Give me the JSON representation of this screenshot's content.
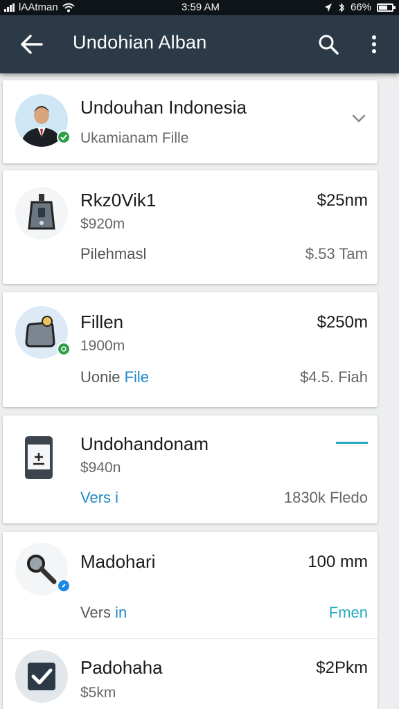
{
  "status_bar": {
    "carrier": "lAAtman",
    "time": "3:59 AM",
    "battery": "66%",
    "battery_level": 0.66
  },
  "app_bar": {
    "title": "Undohian Alban",
    "back_icon": "arrow-left-icon",
    "search_icon": "search-icon",
    "more_icon": "more-vert-icon"
  },
  "header_card": {
    "name": "Undouhan Indonesia",
    "subtitle": "Ukamianam Fille",
    "expand_icon": "chevron-down-icon",
    "badge_color": "#2e9e4a"
  },
  "items": [
    {
      "title": "Rkz0Vik1",
      "subtitle": "$920m",
      "meta": "Pilehmasl",
      "meta_accent": "",
      "right_top": "$25nm",
      "right_bottom": "$.53 Tam",
      "icon": "device-icon"
    },
    {
      "title": "Fillen",
      "subtitle": "1900m",
      "meta": "Uonie",
      "meta_accent": " File",
      "right_top": "$250m",
      "right_bottom": "$4.5. Fiah",
      "icon": "file-icon"
    },
    {
      "title": "Undohandonam",
      "subtitle": "$940n",
      "meta": "Vers i",
      "meta_accent": "",
      "right_top": "",
      "right_bottom": "1830k Fledo",
      "icon": "calculator-icon"
    },
    {
      "title": "Madohari",
      "subtitle": "",
      "meta": "Vers",
      "meta_accent": " in",
      "right_top": "100 mm",
      "right_bottom": "Fmen",
      "icon": "magnifier-icon"
    },
    {
      "title": "Padohaha",
      "subtitle": "$5km",
      "meta": "",
      "meta_accent": "",
      "right_top": "$2Pkm",
      "right_bottom": "",
      "icon": "checkbox-icon"
    }
  ],
  "colors": {
    "app_bar": "#2c3a47",
    "accent": "#1e88c8",
    "teal": "#26a9c0",
    "badge_blue": "#1e88e5",
    "badge_green": "#2e9e4a"
  }
}
